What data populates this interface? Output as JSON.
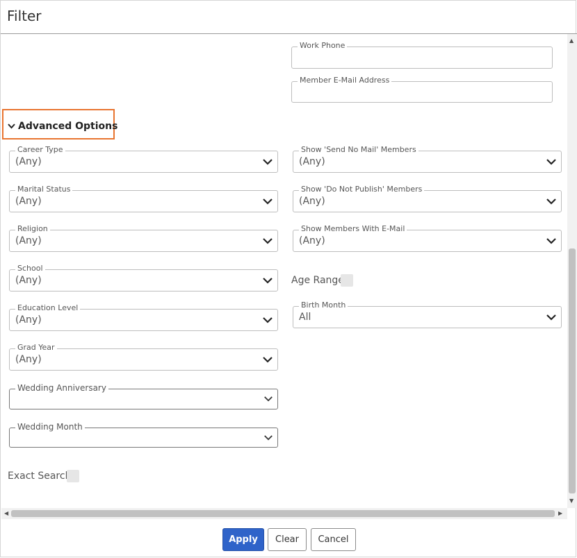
{
  "dialog": {
    "title": "Filter"
  },
  "fields_top": [
    {
      "label": "Work Phone",
      "value": ""
    },
    {
      "label": "Member E-Mail Address",
      "value": ""
    }
  ],
  "advanced": {
    "label": "Advanced Options",
    "icon": "chevron-down-icon",
    "highlight_color": "#e8742f"
  },
  "left_selects": [
    {
      "label": "Career Type",
      "value": "(Any)"
    },
    {
      "label": "Marital Status",
      "value": "(Any)"
    },
    {
      "label": "Religion",
      "value": "(Any)"
    },
    {
      "label": "School",
      "value": "(Any)"
    },
    {
      "label": "Education Level",
      "value": "(Any)"
    },
    {
      "label": "Grad Year",
      "value": "(Any)"
    },
    {
      "label": "Wedding Anniversary",
      "value": ""
    },
    {
      "label": "Wedding Month",
      "value": ""
    }
  ],
  "right_selects": [
    {
      "label": "Show 'Send No Mail' Members",
      "value": "(Any)"
    },
    {
      "label": "Show 'Do Not Publish' Members",
      "value": "(Any)"
    },
    {
      "label": "Show Members With E-Mail",
      "value": "(Any)"
    },
    {
      "label": "Birth Month",
      "value": "All"
    }
  ],
  "age_range": {
    "label": "Age Range",
    "checked": false
  },
  "exact_search": {
    "label": "Exact Search",
    "checked": false
  },
  "buttons": {
    "apply": "Apply",
    "clear": "Clear",
    "cancel": "Cancel"
  },
  "colors": {
    "primary": "#2f63c9"
  }
}
